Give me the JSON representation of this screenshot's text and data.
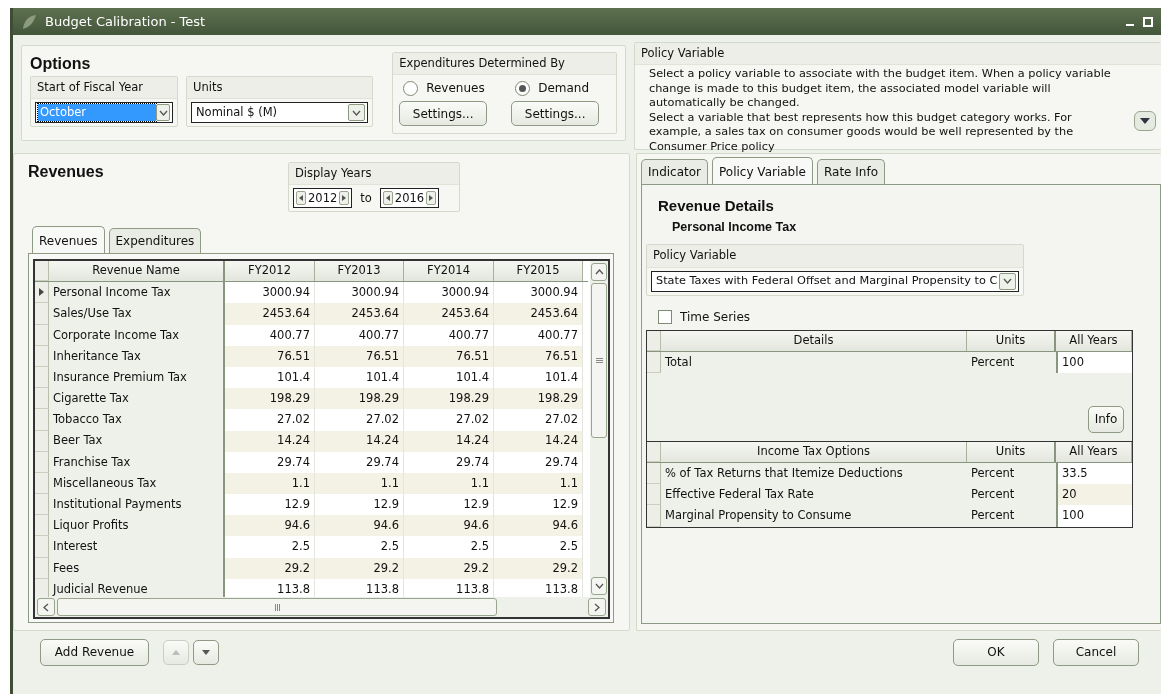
{
  "window": {
    "title": "Budget Calibration - Test"
  },
  "options": {
    "title": "Options",
    "fiscal_year": {
      "label": "Start of Fiscal Year",
      "value": "October",
      "focused": true
    },
    "units": {
      "label": "Units",
      "value": "Nominal $ (M)"
    },
    "expenditures": {
      "label": "Expenditures Determined By",
      "choices": [
        {
          "label": "Revenues",
          "selected": false,
          "button": "Settings..."
        },
        {
          "label": "Demand",
          "selected": true,
          "button": "Settings..."
        }
      ]
    }
  },
  "policy_info": {
    "title": "Policy Variable",
    "paragraphs": [
      "Select a policy variable to associate with the budget item. When a policy variable change is made to this budget item, the associated model variable will automatically be changed.",
      "Select a variable that best represents how this budget category works. For example, a sales tax on consumer goods would be well represented by the Consumer Price policy"
    ]
  },
  "revenues": {
    "title": "Revenues",
    "display_years": {
      "label": "Display Years",
      "from": "2012",
      "between": "to",
      "to": "2016"
    },
    "tabs": [
      {
        "label": "Revenues",
        "selected": true
      },
      {
        "label": "Expenditures",
        "selected": false
      }
    ],
    "columns": [
      "Revenue Name",
      "FY2012",
      "FY2013",
      "FY2014",
      "FY2015"
    ],
    "rows": [
      {
        "name": "Personal Income Tax",
        "values": [
          "3000.94",
          "3000.94",
          "3000.94",
          "3000.94"
        ],
        "current": true
      },
      {
        "name": "Sales/Use Tax",
        "values": [
          "2453.64",
          "2453.64",
          "2453.64",
          "2453.64"
        ],
        "current": false
      },
      {
        "name": "Corporate Income Tax",
        "values": [
          "400.77",
          "400.77",
          "400.77",
          "400.77"
        ],
        "current": false
      },
      {
        "name": "Inheritance Tax",
        "values": [
          "76.51",
          "76.51",
          "76.51",
          "76.51"
        ],
        "current": false
      },
      {
        "name": "Insurance Premium Tax",
        "values": [
          "101.4",
          "101.4",
          "101.4",
          "101.4"
        ],
        "current": false
      },
      {
        "name": "Cigarette Tax",
        "values": [
          "198.29",
          "198.29",
          "198.29",
          "198.29"
        ],
        "current": false
      },
      {
        "name": "Tobacco Tax",
        "values": [
          "27.02",
          "27.02",
          "27.02",
          "27.02"
        ],
        "current": false
      },
      {
        "name": "Beer Tax",
        "values": [
          "14.24",
          "14.24",
          "14.24",
          "14.24"
        ],
        "current": false
      },
      {
        "name": "Franchise Tax",
        "values": [
          "29.74",
          "29.74",
          "29.74",
          "29.74"
        ],
        "current": false
      },
      {
        "name": "Miscellaneous Tax",
        "values": [
          "1.1",
          "1.1",
          "1.1",
          "1.1"
        ],
        "current": false
      },
      {
        "name": "Institutional Payments",
        "values": [
          "12.9",
          "12.9",
          "12.9",
          "12.9"
        ],
        "current": false
      },
      {
        "name": "Liquor Profits",
        "values": [
          "94.6",
          "94.6",
          "94.6",
          "94.6"
        ],
        "current": false
      },
      {
        "name": "Interest",
        "values": [
          "2.5",
          "2.5",
          "2.5",
          "2.5"
        ],
        "current": false
      },
      {
        "name": "Fees",
        "values": [
          "29.2",
          "29.2",
          "29.2",
          "29.2"
        ],
        "current": false
      },
      {
        "name": "Judicial Revenue",
        "values": [
          "113.8",
          "113.8",
          "113.8",
          "113.8"
        ],
        "current": false
      }
    ]
  },
  "details": {
    "tabs": [
      {
        "label": "Indicator",
        "selected": false
      },
      {
        "label": "Policy Variable",
        "selected": true
      },
      {
        "label": "Rate Info",
        "selected": false
      }
    ],
    "title": "Revenue Details",
    "subtitle": "Personal Income Tax",
    "policy_variable": {
      "label": "Policy Variable",
      "value": "State Taxes with Federal Offset and Marginal Propensity to C"
    },
    "time_series": {
      "label": "Time Series",
      "checked": false
    },
    "detail_table": {
      "columns": [
        "Details",
        "Units",
        "All Years"
      ],
      "rows": [
        {
          "name": "Total",
          "units": "Percent",
          "value": "100"
        }
      ]
    },
    "info_button": "Info",
    "options_table": {
      "columns": [
        "Income Tax Options",
        "Units",
        "All Years"
      ],
      "rows": [
        {
          "name": "% of Tax Returns that Itemize Deductions",
          "units": "Percent",
          "value": "33.5"
        },
        {
          "name": "Effective Federal Tax Rate",
          "units": "Percent",
          "value": "20"
        },
        {
          "name": "Marginal Propensity to Consume",
          "units": "Percent",
          "value": "100"
        }
      ]
    }
  },
  "footer": {
    "add_button": "Add Revenue",
    "move_up": {
      "disabled": true
    },
    "move_down": {
      "disabled": false
    },
    "ok": "OK",
    "cancel": "Cancel"
  }
}
